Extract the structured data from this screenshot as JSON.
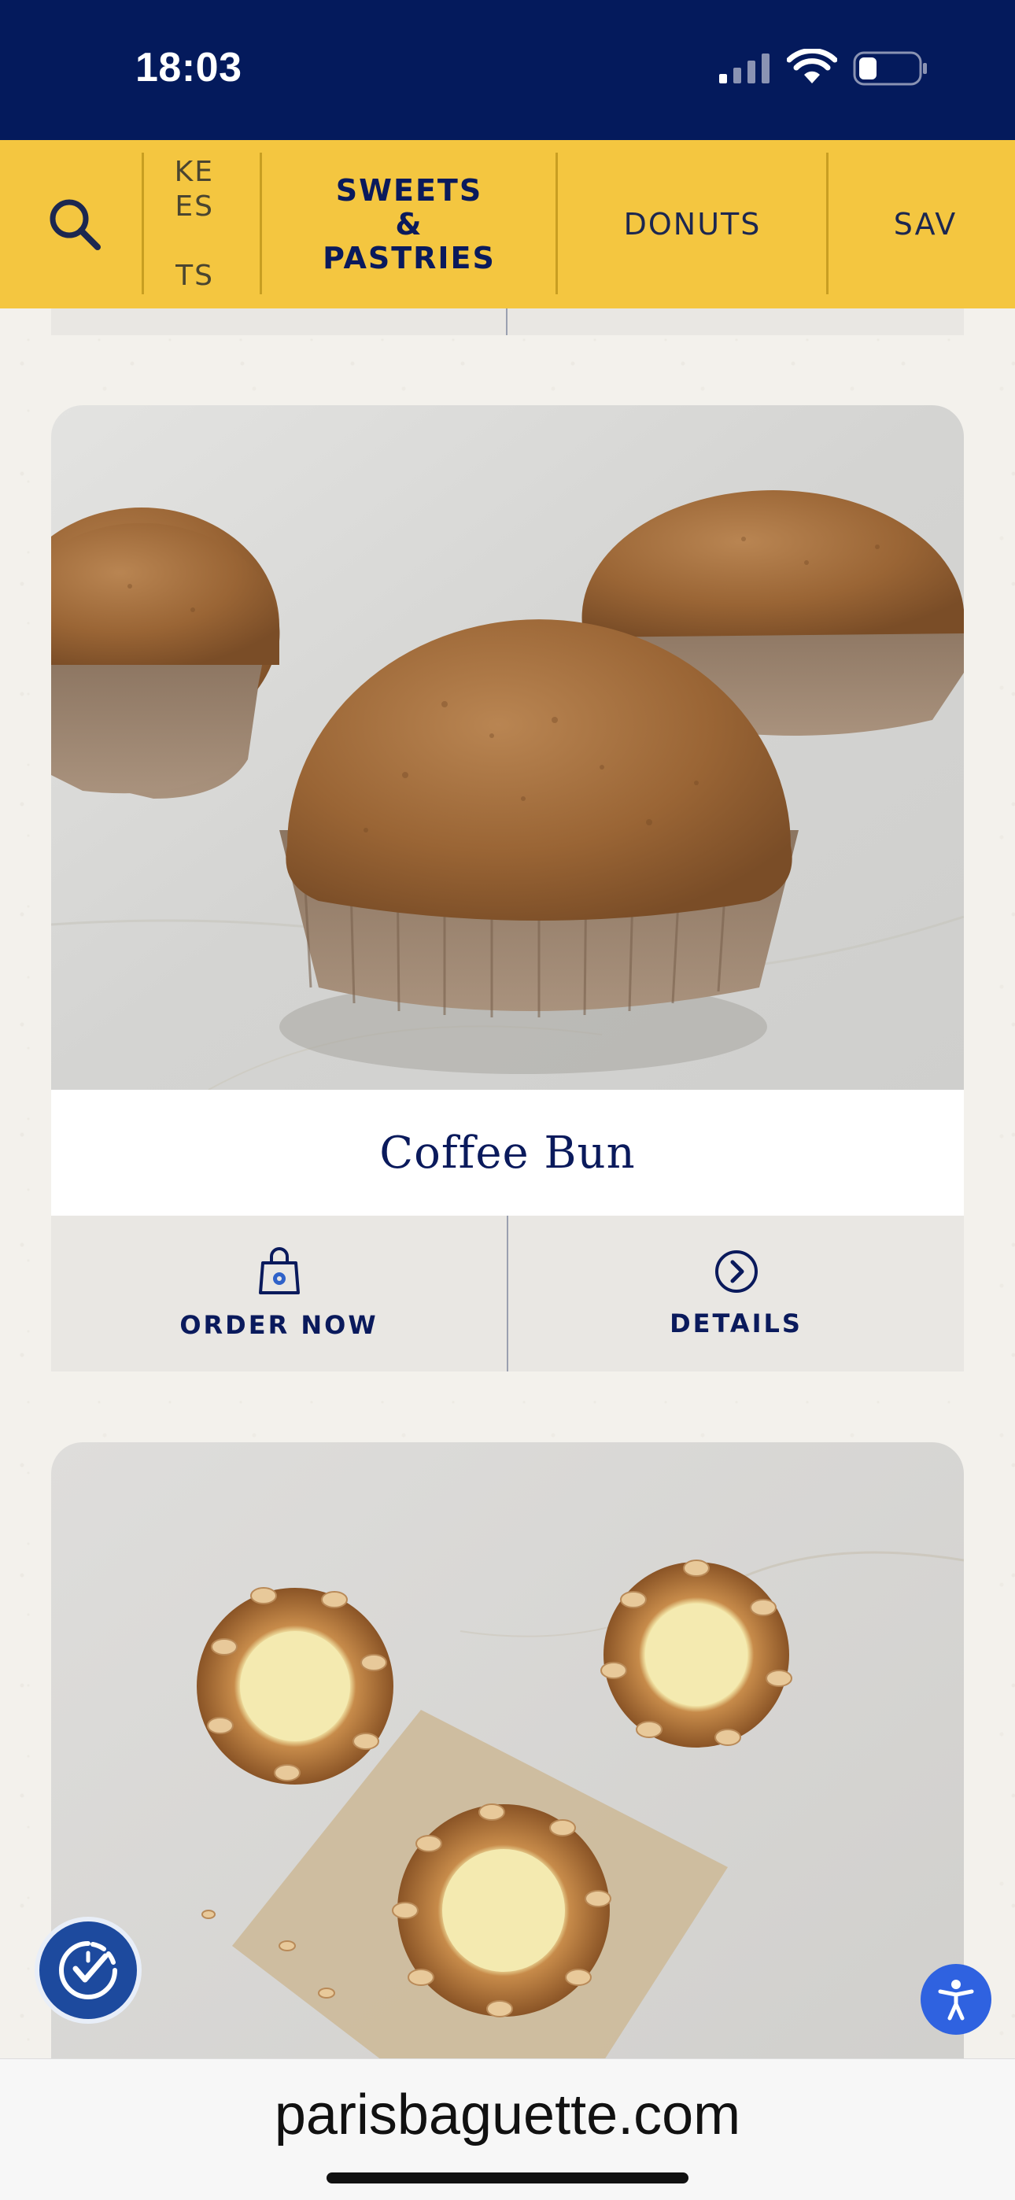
{
  "status_bar": {
    "time": "18:03",
    "icons": [
      "signal-icon",
      "wifi-icon",
      "battery-icon"
    ]
  },
  "category_nav": {
    "search_icon": "search-icon",
    "tabs": [
      {
        "label": "CAKE\nSLICES\n&\nTARTS",
        "visible_text": "KE\nES\n\nTS",
        "active": false
      },
      {
        "label": "SWEETS\n&\nPASTRIES",
        "active": true
      },
      {
        "label": "DONUTS",
        "active": false
      },
      {
        "label": "SAVORY",
        "visible_text": "SAV",
        "active": false
      }
    ]
  },
  "products": [
    {
      "name": "Coffee Bun",
      "order_label": "ORDER NOW",
      "details_label": "DETAILS",
      "order_icon": "shopping-bag-icon",
      "details_icon": "chevron-right-circle-icon"
    },
    {
      "name": "",
      "image": "cream-puff-photo"
    }
  ],
  "floating": {
    "left_icon": "clock-check-icon",
    "right_icon": "accessibility-icon"
  },
  "browser": {
    "url": "parisbaguette.com"
  },
  "colors": {
    "navy": "#041a5c",
    "gold": "#f4c640",
    "text_navy": "#0a1a5c",
    "background": "#f3f1ec"
  }
}
